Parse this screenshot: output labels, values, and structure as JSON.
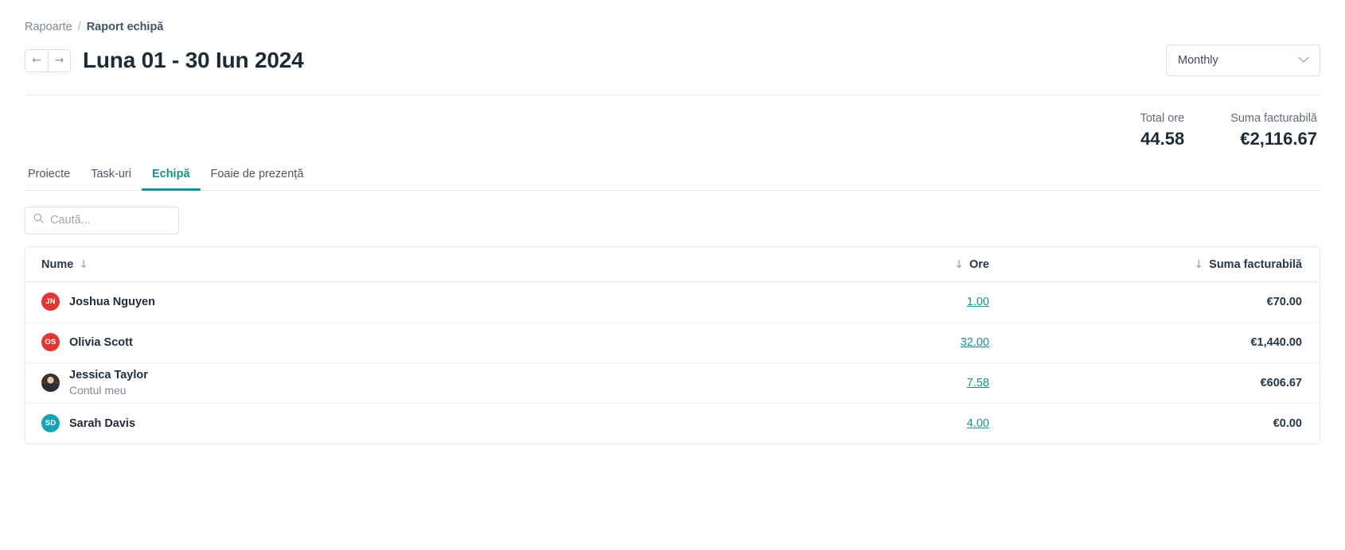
{
  "breadcrumb": {
    "root": "Rapoarte",
    "separator": "/",
    "current": "Raport echipă"
  },
  "header": {
    "prev_label": "←",
    "next_label": "→",
    "title": "Luna 01 - 30 Iun 2024",
    "period_selected": "Monthly",
    "chevron": "⌄"
  },
  "totals": [
    {
      "label": "Total ore",
      "value": "44.58"
    },
    {
      "label": "Suma facturabilă",
      "value": "€2,116.67"
    }
  ],
  "tabs": [
    {
      "label": "Proiecte",
      "active": false
    },
    {
      "label": "Task-uri",
      "active": false
    },
    {
      "label": "Echipă",
      "active": true
    },
    {
      "label": "Foaie de prezență",
      "active": false
    }
  ],
  "search": {
    "placeholder": "Caută...",
    "value": ""
  },
  "table": {
    "headers": {
      "name": "Nume",
      "hours": "Ore",
      "amount": "Suma facturabilă",
      "sort_arrow": "↓"
    },
    "rows": [
      {
        "initials": "JN",
        "avatar_color": "#e43535",
        "avatar_type": "initials",
        "name": "Joshua Nguyen",
        "subtitle": "",
        "hours": "1.00",
        "amount": "€70.00"
      },
      {
        "initials": "OS",
        "avatar_color": "#e43535",
        "avatar_type": "initials",
        "name": "Olivia Scott",
        "subtitle": "",
        "hours": "32.00",
        "amount": "€1,440.00"
      },
      {
        "initials": "",
        "avatar_color": "#c8b5a8",
        "avatar_type": "photo",
        "name": "Jessica Taylor",
        "subtitle": "Contul meu",
        "hours": "7.58",
        "amount": "€606.67"
      },
      {
        "initials": "SD",
        "avatar_color": "#17a2b8",
        "avatar_type": "initials",
        "name": "Sarah Davis",
        "subtitle": "",
        "hours": "4.00",
        "amount": "€0.00"
      }
    ]
  },
  "colors": {
    "accent": "#17908e",
    "text_dark": "#1d2b36",
    "text_muted": "#7b8a96",
    "border": "#e7ebee"
  }
}
